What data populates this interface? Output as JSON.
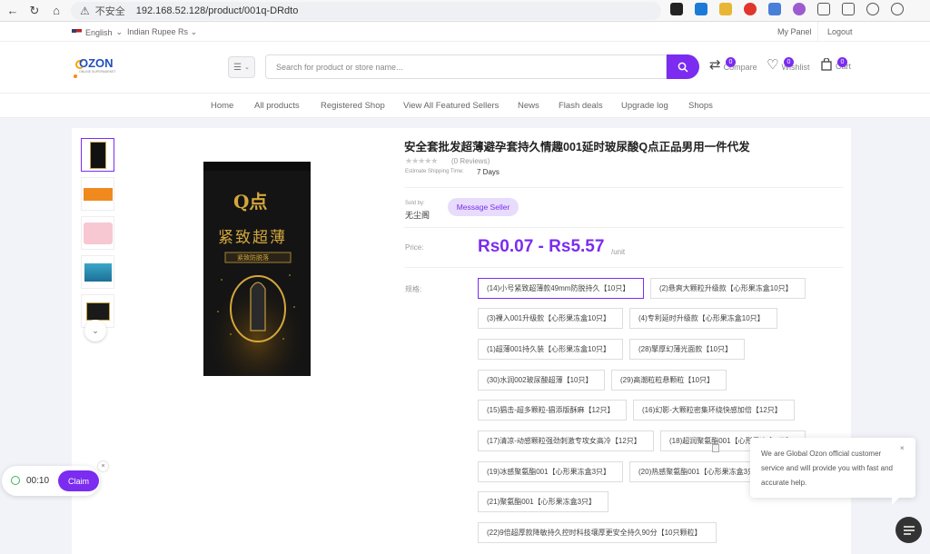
{
  "browser": {
    "insecure_label": "不安全",
    "url": "192.168.52.128/product/001q-DRdto",
    "read_aloud": "Aᴬ"
  },
  "topbar": {
    "language": "English",
    "currency": "Indian Rupee Rs",
    "my_panel": "My Panel",
    "logout": "Logout"
  },
  "header": {
    "logo_text": "OZON",
    "logo_tagline": "ONLINE SUPERMARKET",
    "search_placeholder": "Search for product or store name...",
    "compare": {
      "count": "0",
      "label": "Compare"
    },
    "wishlist": {
      "count": "0",
      "label": "Wishlist"
    },
    "cart": {
      "count": "0",
      "label": "Cart"
    }
  },
  "nav": [
    "Home",
    "All products",
    "Registered Shop",
    "View All Featured Sellers",
    "News",
    "Flash deals",
    "Upgrade log",
    "Shops"
  ],
  "product": {
    "title": "安全套批发超薄避孕套持久情趣001延时玻尿酸Q点正品男用一件代发",
    "stars": "★★★★★",
    "reviews": "(0 Reviews)",
    "shipping_label": "Estimate Shipping Time:",
    "shipping_value": "7 Days",
    "sold_by_label": "Sold by:",
    "sold_by_value": "无尘阁",
    "message_seller": "Message Seller",
    "price_label": "Price:",
    "price": "Rs0.07 - Rs5.57",
    "price_unit": "/unit",
    "spec_label": "规格:",
    "box_brand": "Q点",
    "box_title": "紧致超薄",
    "box_subtitle": "紧致防脱落",
    "options": [
      "(14)小号紧致超薄款49mm防脱持久【10只】",
      "(2)悬爽大颗粒升级款【心形果冻盒10只】",
      "(3)裸入001升级款【心形果冻盒10只】",
      "(4)专利延时升级款【心形果冻盒10只】",
      "(1)超薄001持久装【心形果冻盒10只】",
      "(28)擎厚幻薄光面款【10只】",
      "(30)水润002玻尿酸超薄【10只】",
      "(29)高潮粒粒悬颗粒【10只】",
      "(15)猖击-超多颗粒-猖添版酥麻【12只】",
      "(16)幻影-大颗粒密集环绕快感加倍【12只】",
      "(17)清凉-动感颗粒强劲刺激专攻女高冷【12只】",
      "(18)超润聚氨酯001【心形果冻盒3只】",
      "(19)冰感聚氨酯001【心形果冻盒3只】",
      "(20)热感聚氨酯001【心形果冻盒3只】",
      "(21)聚氨酯001【心形果冻盒3只】",
      "(22)9倍超厚款降敏持久控时科技壤厚更安全持久90分【10只颗粒】"
    ]
  },
  "timer": {
    "time": "00:10",
    "claim": "Claim"
  },
  "chat": {
    "message": "We are Global Ozon official customer service and will provide you with fast and accurate help."
  },
  "colors": {
    "accent": "#7b2cf0",
    "logo_blue": "#1f4fbf"
  }
}
